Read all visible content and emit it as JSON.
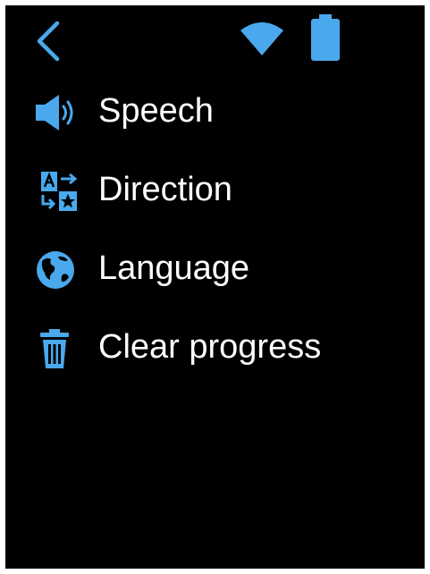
{
  "colors": {
    "background": "#000000",
    "accent": "#4aa8ec",
    "text": "#ffffff"
  },
  "status_bar": {
    "back_icon": "chevron-left-icon",
    "wifi_icon": "wifi-icon",
    "battery_icon": "battery-icon"
  },
  "menu": {
    "items": [
      {
        "label": "Speech",
        "icon": "speaker-icon"
      },
      {
        "label": "Direction",
        "icon": "translate-direction-icon"
      },
      {
        "label": "Language",
        "icon": "globe-icon"
      },
      {
        "label": "Clear progress",
        "icon": "trash-icon"
      }
    ]
  }
}
